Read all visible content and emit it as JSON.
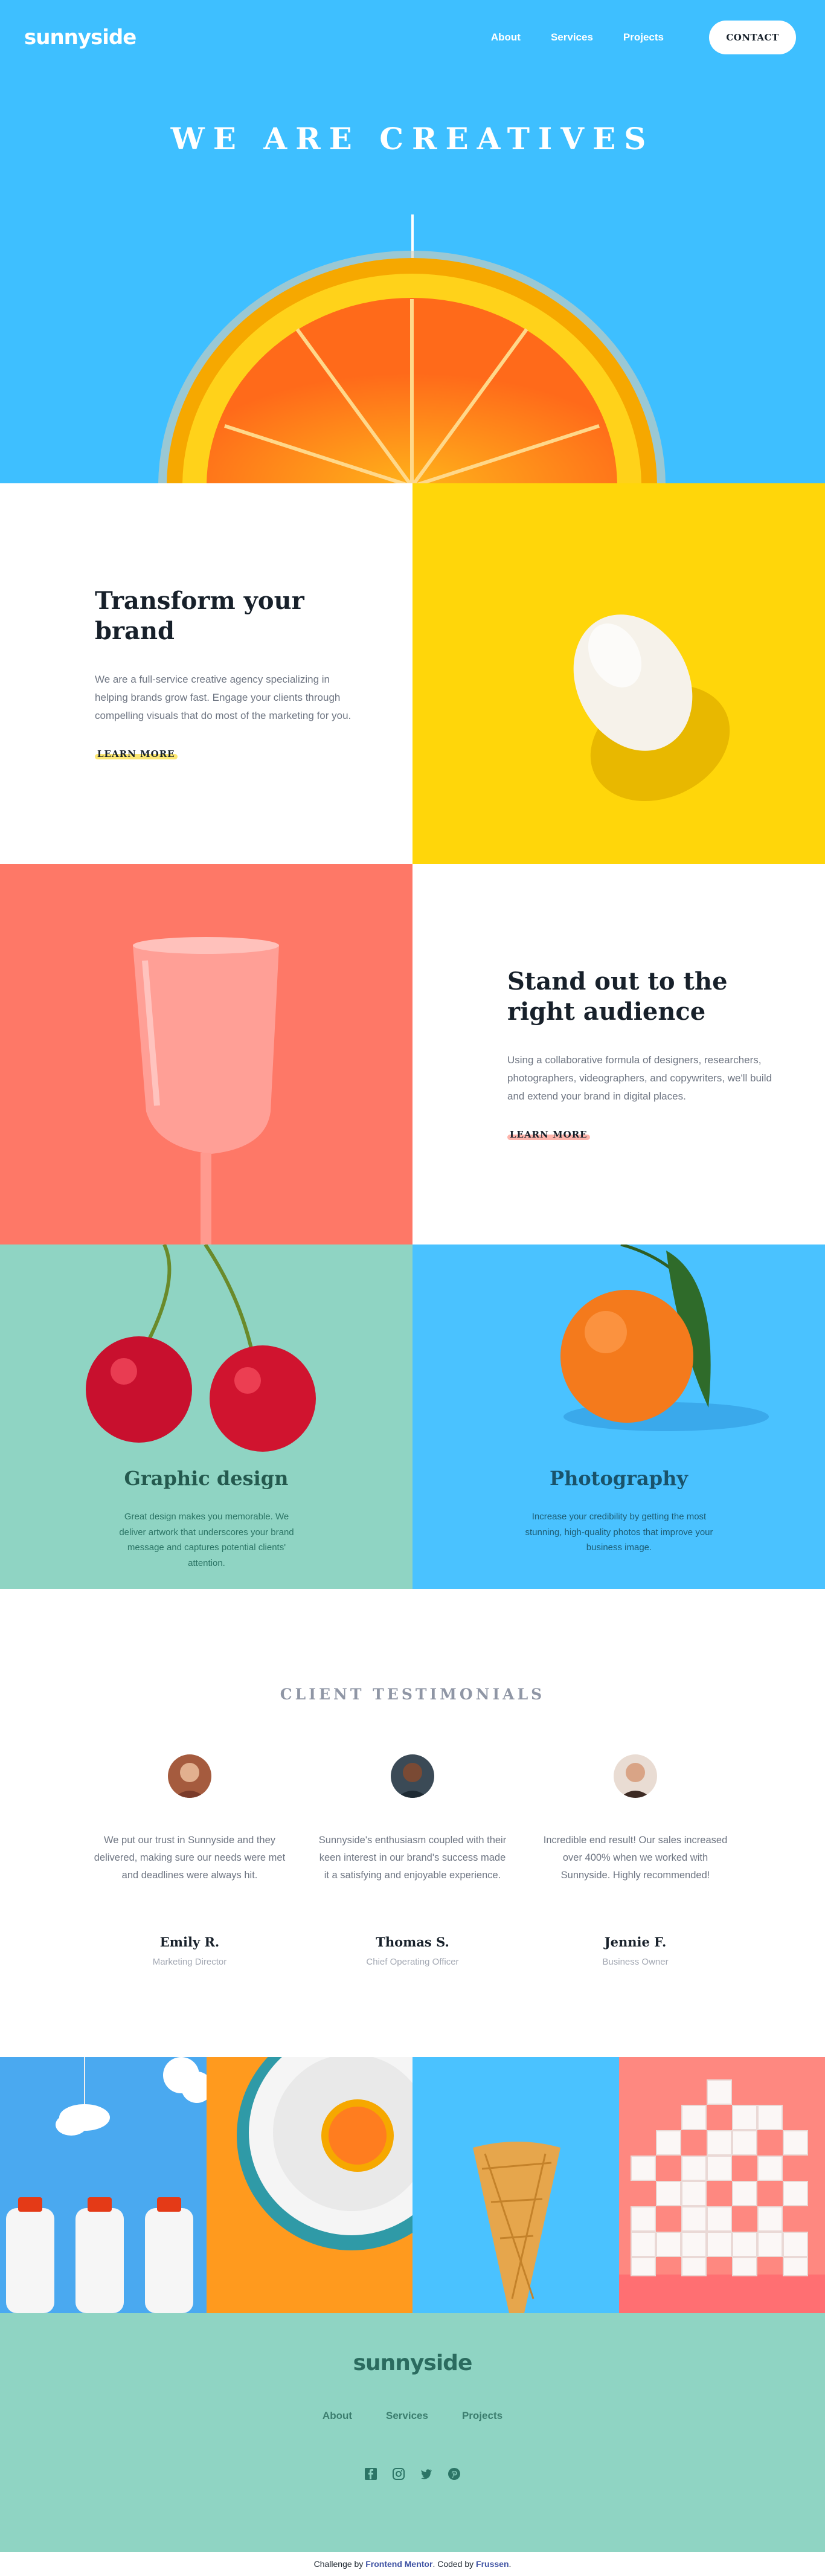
{
  "brand": {
    "logo": "sunnyside"
  },
  "nav": {
    "links": [
      "About",
      "Services",
      "Projects"
    ],
    "contact": "CONTACT"
  },
  "hero": {
    "title": "WE ARE CREATIVES"
  },
  "features": [
    {
      "title": "Transform your brand",
      "body": "We are a full-service creative agency specializing in helping brands grow fast. Engage your clients through compelling visuals that do most of the marketing for you.",
      "cta": "LEARN MORE",
      "accent": "#fad400"
    },
    {
      "title": "Stand out to the right audience",
      "body": "Using a collaborative formula of designers, researchers, photographers, videographers, and copywriters, we'll build and extend your brand in digital places.",
      "cta": "LEARN MORE",
      "accent": "#fe7867"
    }
  ],
  "services": [
    {
      "title": "Graphic design",
      "body": "Great design makes you memorable. We deliver artwork that underscores your brand message and captures potential clients' attention.",
      "title_color": "#24594e",
      "body_color": "#2c7566"
    },
    {
      "title": "Photography",
      "body": "Increase your credibility by getting the most stunning, high-quality photos that improve your business image.",
      "title_color": "#19536b",
      "body_color": "#1d5c74"
    }
  ],
  "testimonials": {
    "heading": "CLIENT TESTIMONIALS",
    "items": [
      {
        "quote": "We put our trust in Sunnyside and they delivered, making sure our needs were met and deadlines were always hit.",
        "name": "Emily R.",
        "role": "Marketing Director"
      },
      {
        "quote": "Sunnyside's enthusiasm coupled with their keen interest in our brand's success made it a satisfying and enjoyable experience.",
        "name": "Thomas S.",
        "role": "Chief Operating Officer"
      },
      {
        "quote": "Incredible end result! Our sales increased over 400% when we worked with Sunnyside. Highly recommended!",
        "name": "Jennie F.",
        "role": "Business Owner"
      }
    ]
  },
  "footer": {
    "logo": "sunnyside",
    "links": [
      "About",
      "Services",
      "Projects"
    ],
    "social": [
      "facebook-icon",
      "instagram-icon",
      "twitter-icon",
      "pinterest-icon"
    ]
  },
  "attribution": {
    "prefix": "Challenge by",
    "challenge_by": "Frontend Mentor",
    "coded_by_prefix": ". Coded by",
    "coded_by": "Frussen",
    "suffix": "."
  },
  "colors": {
    "hero_bg": "#3ebfff",
    "egg_bg": "#ffd60a",
    "glass_bg": "#fe7867",
    "green": "#8fd4c3",
    "blue": "#4ac2ff"
  }
}
